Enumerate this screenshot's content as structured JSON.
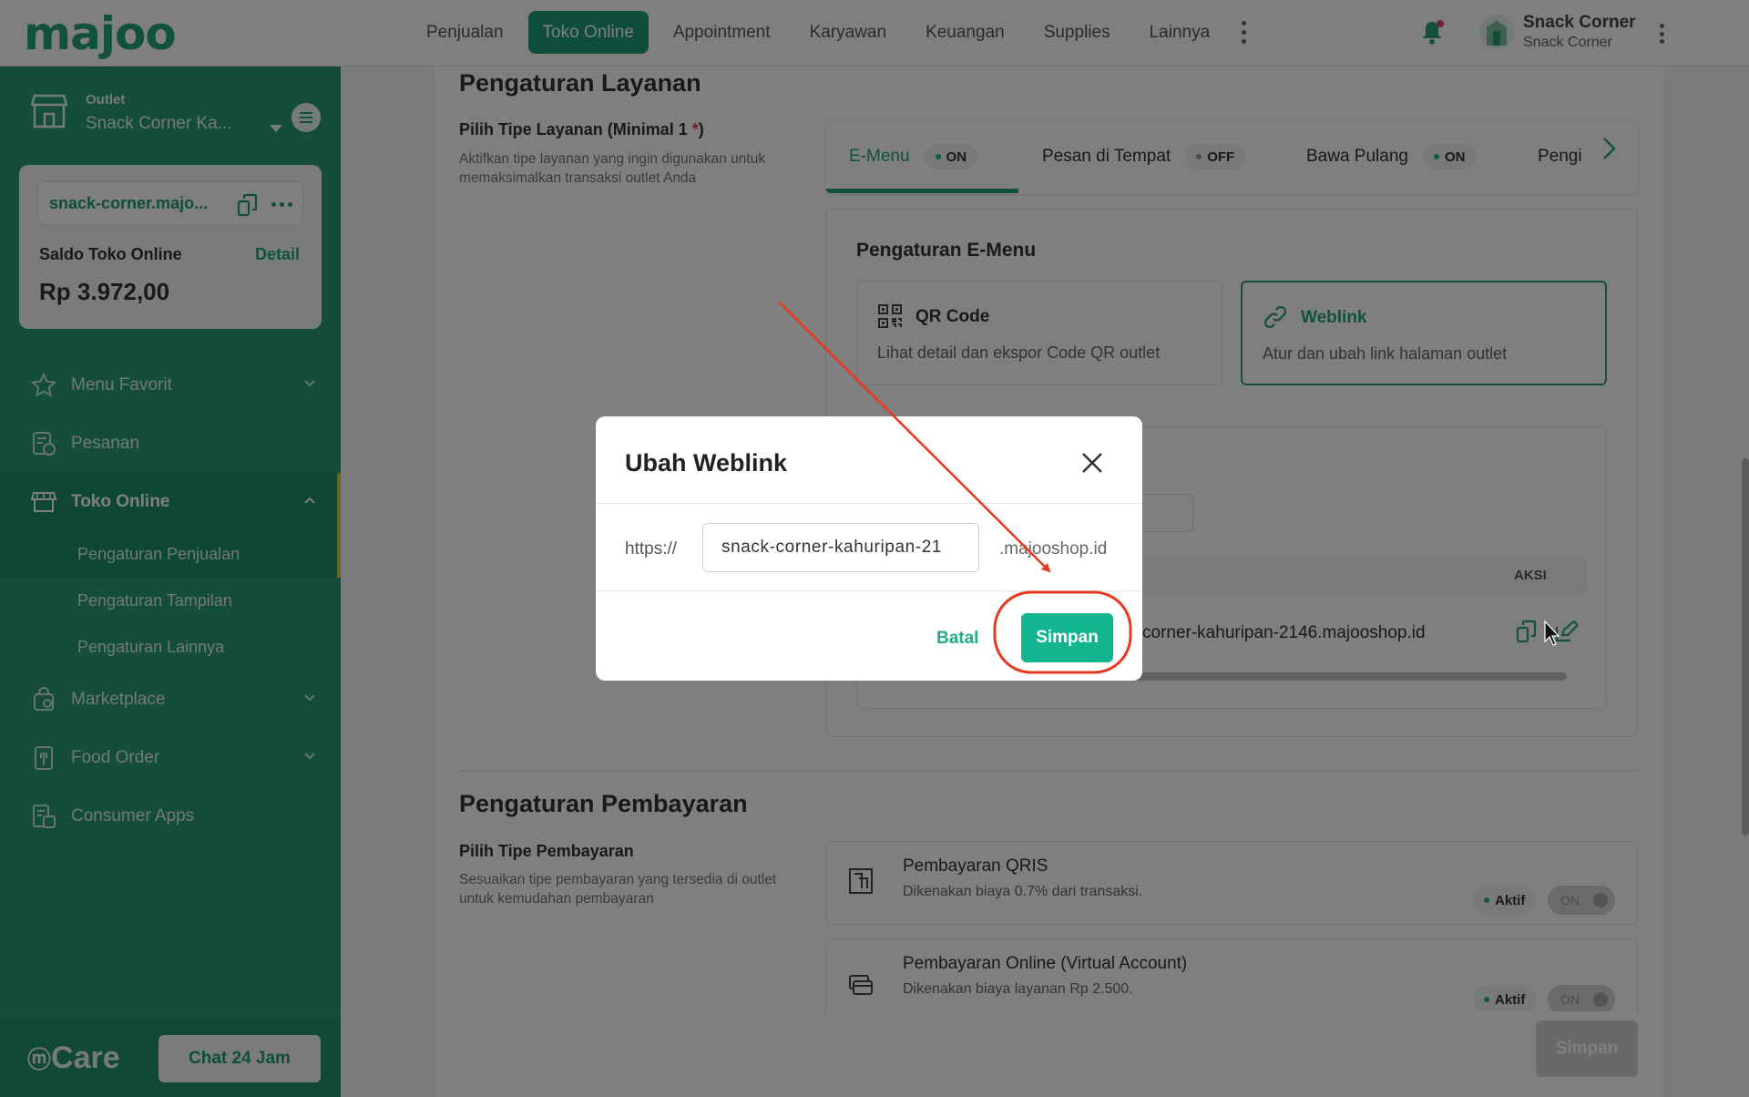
{
  "brand": {
    "logo": "majoo",
    "accent": "#22a37c"
  },
  "topnav": {
    "items": [
      "Penjualan",
      "Toko Online",
      "Appointment",
      "Karyawan",
      "Keuangan",
      "Supplies",
      "Lainnya"
    ],
    "active": "Toko Online",
    "user_name": "Snack Corner",
    "user_outlet": "Snack Corner"
  },
  "sidebar": {
    "outlet_label": "Outlet",
    "outlet_name": "Snack Corner Ka...",
    "store_url": "snack-corner.majo...",
    "balance_label": "Saldo Toko Online",
    "balance_detail": "Detail",
    "balance_amount": "Rp 3.972,00",
    "menu": [
      {
        "label": "Menu Favorit",
        "icon": "star-icon"
      },
      {
        "label": "Pesanan",
        "icon": "orders-icon"
      },
      {
        "label": "Toko Online",
        "icon": "store-icon"
      },
      {
        "label": "Marketplace",
        "icon": "marketplace-icon"
      },
      {
        "label": "Food Order",
        "icon": "food-order-icon"
      },
      {
        "label": "Consumer Apps",
        "icon": "consumer-apps-icon"
      }
    ],
    "submenu": [
      "Pengaturan Penjualan",
      "Pengaturan Tampilan",
      "Pengaturan Lainnya"
    ],
    "care_logo": "Care",
    "chat_button": "Chat 24 Jam"
  },
  "layanan": {
    "title": "Pengaturan Layanan",
    "subtitle": "Pilih Tipe Layanan (Minimal 1",
    "required_mark": "*",
    "subtitle_end": ")",
    "description": "Aktifkan tipe layanan yang ingin digunakan untuk memaksimalkan transaksi outlet Anda",
    "tabs": [
      {
        "label": "E-Menu",
        "status": "ON"
      },
      {
        "label": "Pesan di Tempat",
        "status": "OFF"
      },
      {
        "label": "Bawa Pulang",
        "status": "ON"
      },
      {
        "label": "Pengi",
        "status": ""
      }
    ],
    "emenu_title": "Pengaturan E-Menu",
    "options": [
      {
        "title": "QR Code",
        "desc": "Lihat detail dan ekspor Code QR outlet"
      },
      {
        "title": "Weblink",
        "desc": "Atur dan ubah link halaman outlet"
      }
    ],
    "table_header_action": "AKSI",
    "table_row_url": "corner-kahuripan-2146.majooshop.id"
  },
  "pembayaran": {
    "title": "Pengaturan Pembayaran",
    "subtitle": "Pilih Tipe Pembayaran",
    "description": "Sesuaikan tipe pembayaran yang tersedia di outlet untuk kemudahan pembayaran",
    "items": [
      {
        "title": "Pembayaran QRIS",
        "desc": "Dikenakan biaya 0.7% dari transaksi.",
        "status": "Aktif",
        "toggle": "ON"
      },
      {
        "title": "Pembayaran Online (Virtual Account)",
        "desc": "Dikenakan biaya layanan Rp 2.500.",
        "status": "Aktif",
        "toggle": "ON"
      }
    ],
    "save_button": "Simpan"
  },
  "modal": {
    "title": "Ubah Weblink",
    "prefix": "https://",
    "input_value": "snack-corner-kahuripan-21",
    "suffix": ".majooshop.id",
    "cancel": "Batal",
    "save": "Simpan"
  }
}
